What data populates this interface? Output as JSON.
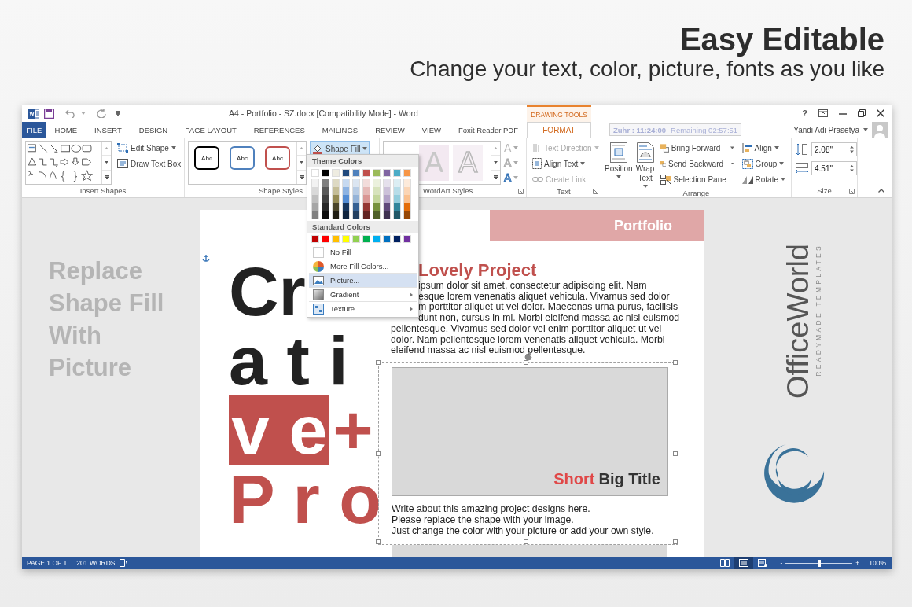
{
  "header": {
    "title": "Easy Editable",
    "subtitle": "Change your text, color, picture, fonts as you like"
  },
  "window": {
    "title": "A4 - Portfolio - SZ.docx [Compatibility Mode] - Word",
    "contextual_label": "DRAWING TOOLS",
    "help": "?",
    "timer": {
      "prayer": "Zuhr : 11:24:00",
      "remaining": "Remaining 02:57:51"
    },
    "user": "Yandi Adi Prasetya"
  },
  "tabs": [
    {
      "label": "FILE",
      "kind": "file",
      "selected": false
    },
    {
      "label": "HOME",
      "kind": "normal",
      "selected": false
    },
    {
      "label": "INSERT",
      "kind": "normal",
      "selected": false
    },
    {
      "label": "DESIGN",
      "kind": "normal",
      "selected": false
    },
    {
      "label": "PAGE LAYOUT",
      "kind": "normal",
      "selected": false
    },
    {
      "label": "REFERENCES",
      "kind": "normal",
      "selected": false
    },
    {
      "label": "MAILINGS",
      "kind": "normal",
      "selected": false
    },
    {
      "label": "REVIEW",
      "kind": "normal",
      "selected": false
    },
    {
      "label": "VIEW",
      "kind": "normal",
      "selected": false
    },
    {
      "label": "Foxit Reader PDF",
      "kind": "normal",
      "selected": false
    },
    {
      "label": "FORMAT",
      "kind": "contextual",
      "selected": true
    }
  ],
  "ribbon": {
    "insert_shapes": {
      "label": "Insert Shapes",
      "buttons": [
        {
          "label": "Edit Shape",
          "kind": "edit_shape",
          "dropdown": true
        },
        {
          "label": "Draw Text Box",
          "kind": "text_box",
          "dropdown": false
        }
      ]
    },
    "shape_styles": {
      "label": "Shape Styles",
      "presets": [
        {
          "text": "Abc",
          "color": "#000000"
        },
        {
          "text": "Abc",
          "color": "#4f81bd"
        },
        {
          "text": "Abc",
          "color": "#c0504d"
        }
      ],
      "shape_fill": {
        "label": "Shape Fill",
        "open": true
      }
    },
    "wordart_styles": {
      "label": "WordArt Styles",
      "presets": [
        {
          "text": "A",
          "kind": "flat"
        },
        {
          "text": "A",
          "kind": "outline"
        }
      ],
      "effects": [
        {
          "text": "A",
          "kind": "fill"
        },
        {
          "text": "A",
          "kind": "outline"
        },
        {
          "text": "A",
          "kind": "effects"
        }
      ]
    },
    "text": {
      "label": "Text",
      "buttons": [
        {
          "label": "Text Direction",
          "kind": "text_direction",
          "dropdown": true,
          "disabled": true
        },
        {
          "label": "Align Text",
          "kind": "align_text",
          "dropdown": true,
          "disabled": false
        },
        {
          "label": "Create Link",
          "kind": "create_link",
          "dropdown": false,
          "disabled": true
        }
      ]
    },
    "arrange": {
      "label": "Arrange",
      "large_buttons": [
        {
          "label": "Position",
          "kind": "position"
        },
        {
          "label": "Wrap Text",
          "kind": "wrap"
        }
      ],
      "buttons": [
        {
          "label": "Bring Forward",
          "kind": "bring_forward",
          "dropdown": true,
          "split": true
        },
        {
          "label": "Send Backward",
          "kind": "send_backward",
          "dropdown": true,
          "split": true
        },
        {
          "label": "Selection Pane",
          "kind": "selection_pane",
          "dropdown": false
        },
        {
          "label": "Align",
          "kind": "align",
          "dropdown": true,
          "split": false
        },
        {
          "label": "Group",
          "kind": "group",
          "dropdown": true,
          "split": false
        },
        {
          "label": "Rotate",
          "kind": "rotate",
          "dropdown": true,
          "split": false
        }
      ]
    },
    "size": {
      "label": "Size",
      "fields": [
        {
          "kind": "height",
          "value": "2.08\""
        },
        {
          "kind": "width",
          "value": "4.51\""
        }
      ]
    }
  },
  "shape_fill_menu": {
    "theme_heading": "Theme Colors",
    "theme_colors": [
      {
        "color": "#ffffff"
      },
      {
        "color": "#000000"
      },
      {
        "color": "#eeece1"
      },
      {
        "color": "#1f497d"
      },
      {
        "color": "#4f81bd"
      },
      {
        "color": "#c0504d"
      },
      {
        "color": "#9bbb59"
      },
      {
        "color": "#8064a2"
      },
      {
        "color": "#4bacc6"
      },
      {
        "color": "#f79646"
      }
    ],
    "theme_shades": [
      [
        {
          "color": "#f2f2f2"
        },
        {
          "color": "#7f7f7f"
        },
        {
          "color": "#ddd9c3"
        },
        {
          "color": "#c6d9f0"
        },
        {
          "color": "#dbe5f1"
        },
        {
          "color": "#f2dcdb"
        },
        {
          "color": "#ebf1dd"
        },
        {
          "color": "#e5e0ec"
        },
        {
          "color": "#dbeef3"
        },
        {
          "color": "#fdeada"
        }
      ],
      [
        {
          "color": "#d9d9d9"
        },
        {
          "color": "#595959"
        },
        {
          "color": "#c4bd97"
        },
        {
          "color": "#8db3e2"
        },
        {
          "color": "#b8cce4"
        },
        {
          "color": "#e5b9b7"
        },
        {
          "color": "#d7e3bc"
        },
        {
          "color": "#ccc1d9"
        },
        {
          "color": "#b7dde8"
        },
        {
          "color": "#fbd5b5"
        }
      ],
      [
        {
          "color": "#bfbfbf"
        },
        {
          "color": "#404040"
        },
        {
          "color": "#948a54"
        },
        {
          "color": "#548dd4"
        },
        {
          "color": "#95b3d7"
        },
        {
          "color": "#d99694"
        },
        {
          "color": "#c3d69b"
        },
        {
          "color": "#b2a2c7"
        },
        {
          "color": "#92cddc"
        },
        {
          "color": "#fac08f"
        }
      ],
      [
        {
          "color": "#a6a6a6"
        },
        {
          "color": "#262626"
        },
        {
          "color": "#4a452a"
        },
        {
          "color": "#17365d"
        },
        {
          "color": "#366092"
        },
        {
          "color": "#953734"
        },
        {
          "color": "#76923c"
        },
        {
          "color": "#5f497a"
        },
        {
          "color": "#31859b"
        },
        {
          "color": "#e36c09"
        }
      ],
      [
        {
          "color": "#808080"
        },
        {
          "color": "#0d0d0d"
        },
        {
          "color": "#1e1c11"
        },
        {
          "color": "#0f243e"
        },
        {
          "color": "#244061"
        },
        {
          "color": "#632423"
        },
        {
          "color": "#4f6128"
        },
        {
          "color": "#3f3151"
        },
        {
          "color": "#205867"
        },
        {
          "color": "#974806"
        }
      ]
    ],
    "standard_heading": "Standard Colors",
    "standard_colors": [
      {
        "color": "#c00000"
      },
      {
        "color": "#ff0000"
      },
      {
        "color": "#ffc000"
      },
      {
        "color": "#ffff00"
      },
      {
        "color": "#92d050"
      },
      {
        "color": "#00b050"
      },
      {
        "color": "#00b0f0"
      },
      {
        "color": "#0070c0"
      },
      {
        "color": "#002060"
      },
      {
        "color": "#7030a0"
      }
    ],
    "items": [
      {
        "label": "No Fill",
        "kind": "no_fill",
        "selected": false,
        "submenu": false
      },
      {
        "label": "More Fill Colors...",
        "kind": "palette",
        "selected": false,
        "submenu": false
      },
      {
        "label": "Picture...",
        "kind": "picture",
        "selected": true,
        "submenu": false
      },
      {
        "label": "Gradient",
        "kind": "gradient",
        "selected": false,
        "submenu": true
      },
      {
        "label": "Texture",
        "kind": "texture",
        "selected": false,
        "submenu": true
      }
    ]
  },
  "side_note": {
    "lines": [
      "Replace",
      "Shape Fill",
      "With",
      "Picture"
    ]
  },
  "document": {
    "banner": "Portfolio",
    "big_lines": [
      [
        {
          "text": "Cr",
          "kind": "dark"
        }
      ],
      [
        {
          "text": "a t i",
          "kind": "dark"
        }
      ],
      [
        {
          "text": "v e",
          "kind": "boxed"
        },
        {
          "text": "+",
          "kind": "accent"
        }
      ],
      [
        {
          "text": "P r o",
          "kind": "accent"
        }
      ]
    ],
    "heading": {
      "text": "Lovely Project",
      "clipped": true
    },
    "paragraph_lines": [
      {
        "text": "ipsum dolor sit amet, consectetur adipiscing elit. Nam",
        "clipped": true
      },
      {
        "text": "esque lorem venenatis aliquet vehicula. Vivamus sed dolor",
        "clipped": true
      },
      {
        "text": "m porttitor aliquet ut vel dolor. Maecenas urna purus, facilisis",
        "clipped": true
      },
      {
        "text": "dunt non, cursus in mi. Morbi eleifend massa ac nisl euismod",
        "clipped": true
      },
      {
        "text": "pellentesque. Vivamus sed dolor vel enim porttitor aliquet ut vel",
        "clipped": false
      },
      {
        "text": "dolor. Nam pellentesque lorem venenatis aliquet vehicula. Morbi",
        "clipped": false
      },
      {
        "text": "eleifend massa ac nisl euismod pellentesque.",
        "clipped": false
      }
    ],
    "image_shape": {
      "title_accent": "Short",
      "title": "Big Title"
    },
    "caption_lines": [
      "Write about this amazing project designs here.",
      "Please replace the shape with your image.",
      "Just change the color with your picture or add your own style."
    ]
  },
  "brand": {
    "name": "OfficeWorld",
    "tagline": "READYMADE TEMPLATES"
  },
  "status_bar": {
    "page": "PAGE 1 OF 1",
    "words": "201 WORDS",
    "views": [
      {
        "kind": "read",
        "selected": false
      },
      {
        "kind": "print",
        "selected": true
      },
      {
        "kind": "web",
        "selected": false
      }
    ],
    "zoom": {
      "minus": "-",
      "plus": "+",
      "level": 0.5,
      "reading": "100%"
    }
  }
}
